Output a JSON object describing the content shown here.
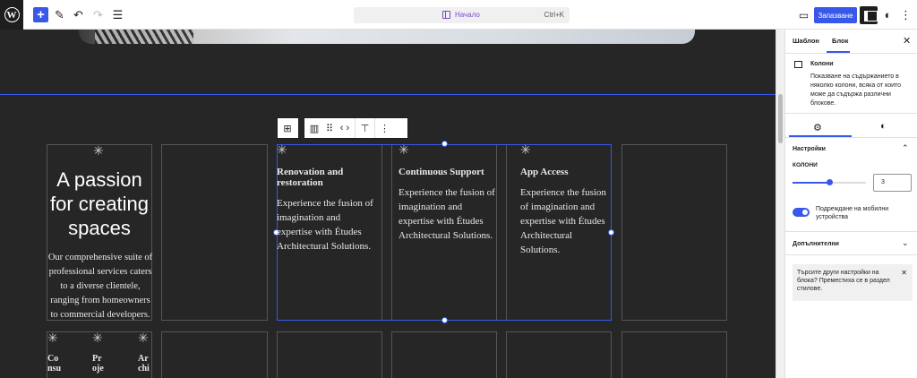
{
  "topbar": {
    "command_label": "Начало",
    "command_shortcut": "Ctrl+K",
    "save_label": "Запазване"
  },
  "canvas": {
    "heading": "A passion for creating spaces",
    "intro": "Our comprehensive suite of professional services caters to a diverse clientele, ranging from homeowners to commercial developers.",
    "columns": [
      {
        "title": "Renovation and restoration",
        "text": "Experience the fusion of imagination and expertise with Études Architectural Solutions."
      },
      {
        "title": "Continuous Support",
        "text": "Experience the fusion of imagination and expertise with Études Architectural Solutions."
      },
      {
        "title": "App Access",
        "text": "Experience the fusion of imagination and expertise with Études Architectural Solutions."
      }
    ],
    "bottom_items": [
      {
        "line1": "Co",
        "line2": "nsu"
      },
      {
        "line1": "Pr",
        "line2": "oje"
      },
      {
        "line1": "Ar",
        "line2": "chi"
      }
    ]
  },
  "sidebar": {
    "tabs": [
      "Шаблон",
      "Блок"
    ],
    "block_title": "Колони",
    "block_desc": "Показване на съдържанието в няколко колони, всяка от които може да съдържа различни блокове.",
    "settings_title": "Настройки",
    "columns_label": "КОЛОНИ",
    "columns_value": "3",
    "columns_fraction": 0.5,
    "stack_label": "Подреждане на мобилни устройства",
    "additional_label": "Допълнителни",
    "notice_text": "Търсите други настройки на блока? Преместиха се в раздел стилове."
  },
  "colors": {
    "accent": "#3858e9",
    "canvas": "#262626",
    "command": "#7b4ad1"
  }
}
